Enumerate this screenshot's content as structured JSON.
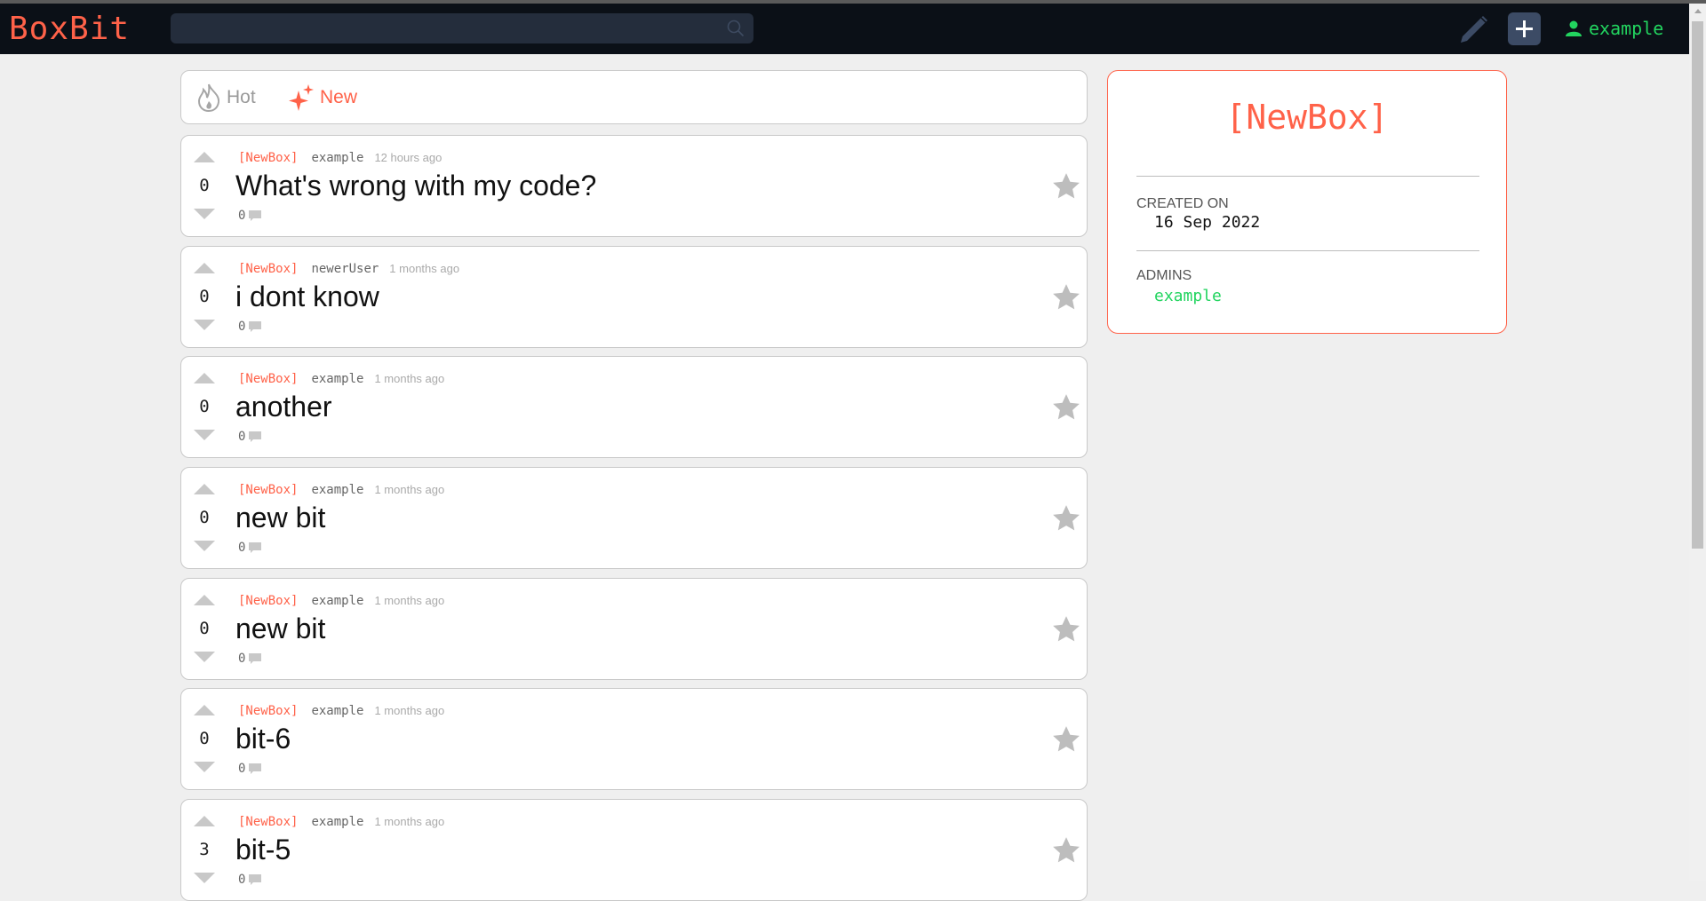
{
  "app": {
    "logo": "BoxBit"
  },
  "header": {
    "search_placeholder": "",
    "user_name": "example"
  },
  "tabs": [
    {
      "label": "Hot",
      "active": false
    },
    {
      "label": "New",
      "active": true
    }
  ],
  "posts": [
    {
      "box": "[NewBox]",
      "author": "example",
      "time": "12 hours ago",
      "title": "What's wrong with my code?",
      "score": "0",
      "comments": "0"
    },
    {
      "box": "[NewBox]",
      "author": "newerUser",
      "time": "1 months ago",
      "title": "i dont know",
      "score": "0",
      "comments": "0"
    },
    {
      "box": "[NewBox]",
      "author": "example",
      "time": "1 months ago",
      "title": "another",
      "score": "0",
      "comments": "0"
    },
    {
      "box": "[NewBox]",
      "author": "example",
      "time": "1 months ago",
      "title": "new bit",
      "score": "0",
      "comments": "0"
    },
    {
      "box": "[NewBox]",
      "author": "example",
      "time": "1 months ago",
      "title": "new bit",
      "score": "0",
      "comments": "0"
    },
    {
      "box": "[NewBox]",
      "author": "example",
      "time": "1 months ago",
      "title": "bit-6",
      "score": "0",
      "comments": "0"
    },
    {
      "box": "[NewBox]",
      "author": "example",
      "time": "1 months ago",
      "title": "bit-5",
      "score": "3",
      "comments": "0"
    }
  ],
  "sidebar": {
    "title": "[NewBox]",
    "created_label": "CREATED ON",
    "created_value": "16 Sep 2022",
    "admins_label": "ADMINS",
    "admins": [
      "example"
    ]
  },
  "colors": {
    "accent": "#ff6249",
    "user": "#22d45f",
    "navbar": "#0b1017"
  }
}
